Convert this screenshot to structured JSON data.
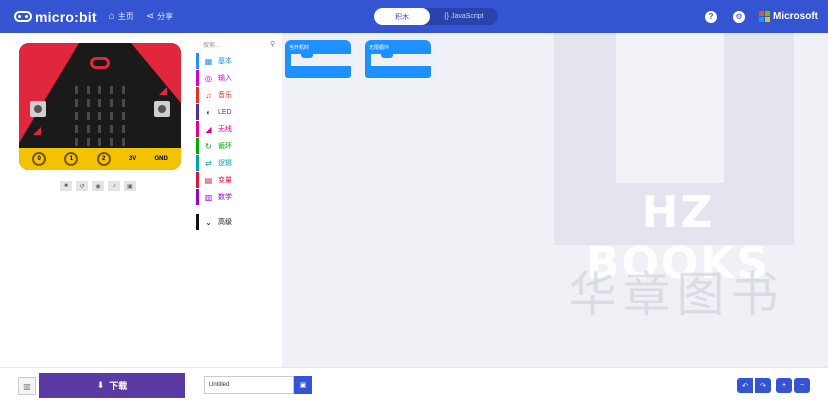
{
  "header": {
    "brand": "micro:bit",
    "home_label": "主页",
    "share_label": "分享",
    "toggle_on": "积木",
    "toggle_off": "{} JavaScript",
    "help_icon": "?",
    "settings_icon": "⚙",
    "microsoft_label": "Microsoft",
    "accent": "#3454d1"
  },
  "simulator": {
    "pins": [
      "0",
      "1",
      "2",
      "3V",
      "GND"
    ],
    "controls": [
      "■",
      "↺",
      "◉",
      "♪",
      "▣"
    ],
    "board_red": "#e0273d",
    "edge_yellow": "#f3c200"
  },
  "toolbox": {
    "search_placeholder": "搜索...",
    "categories": [
      {
        "label": "基本",
        "icon": "grid-icon",
        "glyph": "▦",
        "color": "#1e90ff"
      },
      {
        "label": "输入",
        "icon": "target-icon",
        "glyph": "◎",
        "color": "#d400d4"
      },
      {
        "label": "音乐",
        "icon": "headphones-icon",
        "glyph": "♫",
        "color": "#e63022"
      },
      {
        "label": "LED",
        "icon": "toggle-icon",
        "glyph": "◐",
        "color": "#5c2d91"
      },
      {
        "label": "无线",
        "icon": "signal-icon",
        "glyph": "◢",
        "color": "#e3008c"
      },
      {
        "label": "循环",
        "icon": "refresh-icon",
        "glyph": "↻",
        "color": "#00aa00"
      },
      {
        "label": "逻辑",
        "icon": "shuffle-icon",
        "glyph": "⇄",
        "color": "#00a4a6"
      },
      {
        "label": "变量",
        "icon": "list-icon",
        "glyph": "▤",
        "color": "#dc143c"
      },
      {
        "label": "数学",
        "icon": "calculator-icon",
        "glyph": "▥",
        "color": "#9400d3"
      },
      {
        "label": "高级",
        "icon": "chevron-down-icon",
        "glyph": "⌄",
        "color": "#111111"
      }
    ]
  },
  "workspace": {
    "blocks": [
      {
        "label": "当开机时"
      },
      {
        "label": "无限循环"
      }
    ],
    "watermark_latin": "HZ BOOKS",
    "watermark_cn": "华章图书"
  },
  "footer": {
    "side_toggle": "▥",
    "download_label": "下载",
    "download_icon": "⬇",
    "project_name": "Untitled",
    "save_icon": "💾",
    "undo_icon": "↶",
    "redo_icon": "↷",
    "zoom_in_icon": "+",
    "zoom_out_icon": "−",
    "download_color": "#5c3aa3"
  }
}
